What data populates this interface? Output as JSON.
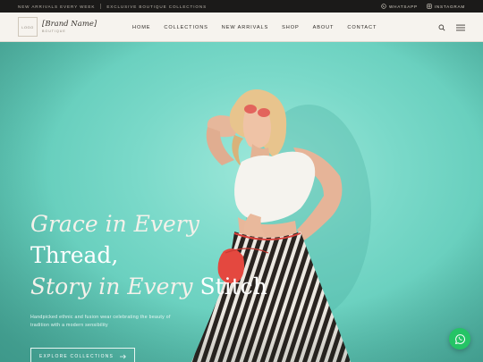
{
  "announcement": {
    "items": [
      "New arrivals every week",
      "Exclusive boutique collections"
    ]
  },
  "social": {
    "whatsapp_label": "WhatsApp",
    "instagram_label": "Instagram"
  },
  "header": {
    "logo_text": "LOGO",
    "brand_name": "[Brand Name]",
    "brand_sub": "Boutique",
    "nav": [
      "Home",
      "Collections",
      "New Arrivals",
      "Shop",
      "About",
      "Contact"
    ]
  },
  "hero": {
    "line1": "Grace in Every",
    "line2": "Thread,",
    "line3_italic": "Story in Every",
    "line3_plain": "Stitch",
    "description": "Handpicked ethnic and fusion wear celebrating the beauty of tradition with a modern sensibility",
    "cta_label": "Explore Collections"
  },
  "icons": [
    "whatsapp-icon",
    "instagram-icon",
    "search-icon",
    "menu-icon",
    "arrow-right-icon"
  ],
  "colors": {
    "topbar": "#1b1a19",
    "header_bg": "#f6f3ee",
    "hero_teal": "#6fd3c4",
    "whatsapp_green": "#25c466"
  }
}
